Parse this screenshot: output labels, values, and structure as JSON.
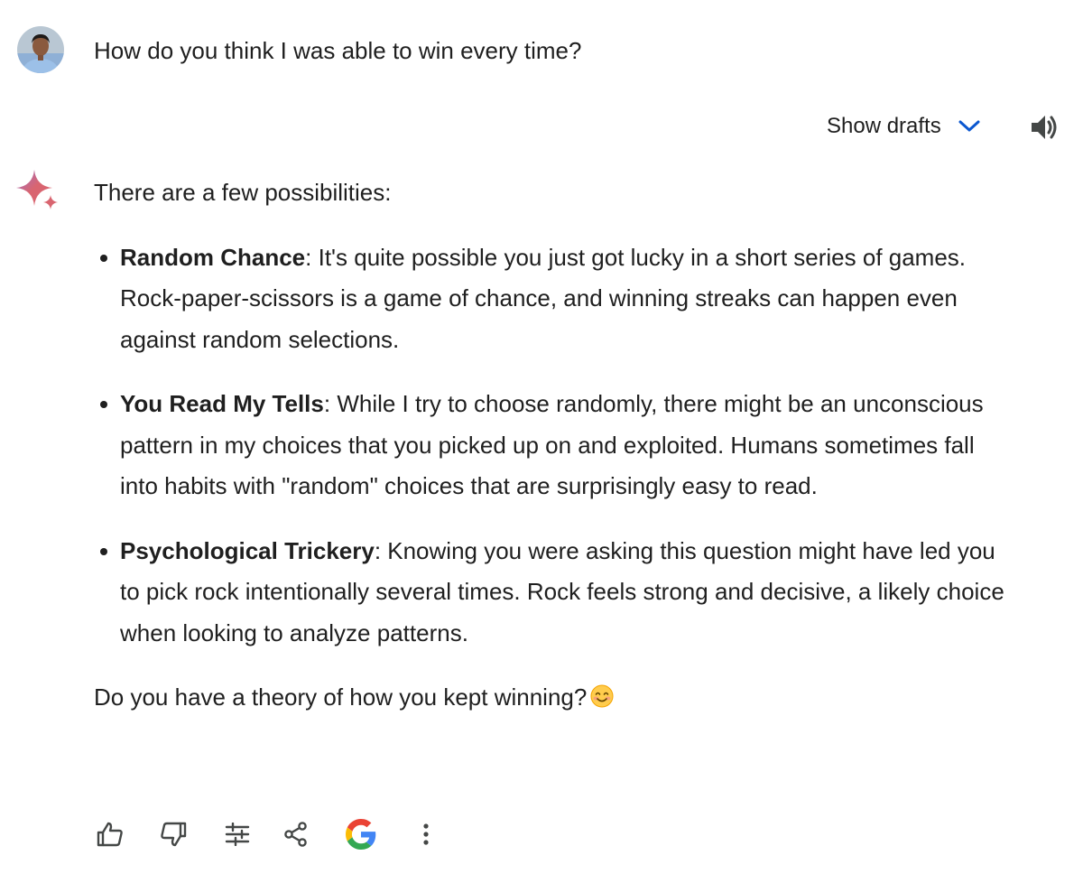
{
  "user": {
    "query": "How do you think I was able to win every time?"
  },
  "drafts": {
    "label": "Show drafts"
  },
  "response": {
    "intro": "There are a few possibilities:",
    "points": [
      {
        "title": "Random Chance",
        "text": ": It's quite possible you just got lucky in a short series of games. Rock-paper-scissors is a game of chance, and winning streaks can happen even against random selections."
      },
      {
        "title": "You Read My Tells",
        "text": ": While I try to choose randomly, there might be an unconscious pattern in my choices that you picked up on and exploited. Humans sometimes fall into habits with \"random\" choices that are surprisingly easy to read."
      },
      {
        "title": "Psychological Trickery",
        "text": ": Knowing you were asking this question might have led you to pick rock intentionally several times. Rock feels strong and decisive, a likely choice when looking to analyze patterns."
      }
    ],
    "outro": "Do you have a theory of how you kept winning?"
  },
  "icons": {
    "avatar": "user-avatar",
    "chevron": "chevron-down-icon",
    "speaker": "speaker-icon",
    "sparkle": "gemini-sparkle-icon",
    "emoji": "smiling-face-emoji",
    "actions": [
      "thumbs-up-icon",
      "thumbs-down-icon",
      "tune-icon",
      "share-icon",
      "google-icon",
      "more-vert-icon"
    ]
  },
  "colors": {
    "text": "#1f1f1f",
    "chevron": "#0b57d0",
    "sparkle": "#d96570",
    "icon": "#444746"
  }
}
